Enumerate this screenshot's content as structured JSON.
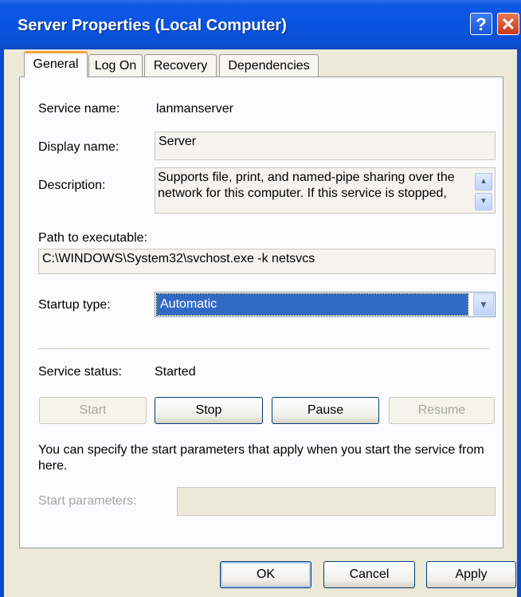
{
  "window": {
    "title": "Server Properties (Local Computer)",
    "help_glyph": "?",
    "close_glyph": "✕"
  },
  "tabs": [
    {
      "label": "General",
      "active": true
    },
    {
      "label": "Log On",
      "active": false
    },
    {
      "label": "Recovery",
      "active": false
    },
    {
      "label": "Dependencies",
      "active": false
    }
  ],
  "general": {
    "service_name_label": "Service name:",
    "service_name_value": "lanmanserver",
    "display_name_label": "Display name:",
    "display_name_value": "Server",
    "description_label": "Description:",
    "description_value": "Supports file, print, and named-pipe sharing over the network for this computer. If this service is stopped,",
    "path_label": "Path to executable:",
    "path_value": "C:\\WINDOWS\\System32\\svchost.exe -k netsvcs",
    "startup_type_label": "Startup type:",
    "startup_type_value": "Automatic",
    "service_status_label": "Service status:",
    "service_status_value": "Started",
    "buttons": {
      "start": "Start",
      "stop": "Stop",
      "pause": "Pause",
      "resume": "Resume"
    },
    "note": "You can specify the start parameters that apply when you start the service from here.",
    "start_params_label": "Start parameters:",
    "start_params_value": ""
  },
  "footer": {
    "ok": "OK",
    "cancel": "Cancel",
    "apply": "Apply"
  },
  "icons": {
    "scroll_up": "▲",
    "scroll_down": "▼",
    "dropdown": "▼"
  }
}
